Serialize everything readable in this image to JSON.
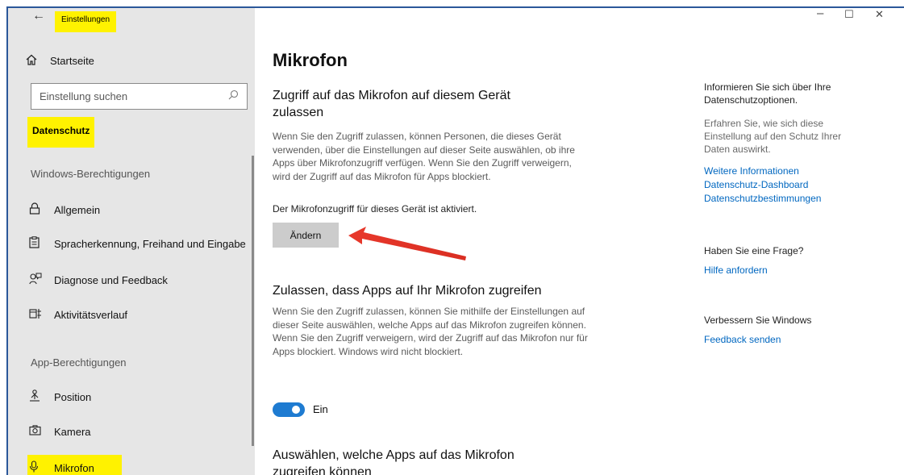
{
  "window": {
    "app_title": "Einstellungen",
    "caption": {
      "minimize": "–",
      "maximize": "☐",
      "close": "✕"
    }
  },
  "sidebar": {
    "home_label": "Startseite",
    "search_placeholder": "Einstellung suchen",
    "section_title": "Datenschutz",
    "windows_permissions_label": "Windows-Berechtigungen",
    "app_permissions_label": "App-Berechtigungen",
    "items": [
      {
        "label": "Allgemein",
        "icon": "lock-icon"
      },
      {
        "label": "Spracherkennung, Freihand und Eingabe",
        "icon": "clipboard-icon"
      },
      {
        "label": "Diagnose und Feedback",
        "icon": "people-feedback-icon"
      },
      {
        "label": "Aktivitätsverlauf",
        "icon": "timeline-icon"
      },
      {
        "label": "Position",
        "icon": "location-person-icon"
      },
      {
        "label": "Kamera",
        "icon": "camera-icon"
      },
      {
        "label": "Mikrofon",
        "icon": "microphone-icon"
      }
    ]
  },
  "main": {
    "page_title": "Mikrofon",
    "device_access": {
      "heading_line1": "Zugriff auf das Mikrofon auf diesem Gerät",
      "heading_line2": "zulassen",
      "description": "Wenn Sie den Zugriff zulassen, können Personen, die dieses Gerät verwenden, über die Einstellungen auf dieser Seite auswählen, ob ihre Apps über Mikrofonzugriff verfügen. Wenn Sie den Zugriff verweigern, wird der Zugriff auf das Mikrofon für Apps blockiert.",
      "status": "Der Mikrofonzugriff für dieses Gerät ist aktiviert.",
      "change_button": "Ändern"
    },
    "app_access": {
      "heading": "Zulassen, dass Apps auf Ihr Mikrofon zugreifen",
      "description": "Wenn Sie den Zugriff zulassen, können Sie mithilfe der Einstellungen auf dieser Seite auswählen, welche Apps auf das Mikrofon zugreifen können. Wenn Sie den Zugriff verweigern, wird der Zugriff auf das Mikrofon nur für Apps blockiert. Windows wird nicht blockiert.",
      "toggle_state": "Ein"
    },
    "choose_apps": {
      "heading_line1": "Auswählen, welche Apps auf das Mikrofon",
      "heading_line2": "zugreifen können"
    }
  },
  "right_panel": {
    "privacy_heading": "Informieren Sie sich über Ihre Datenschutzoptionen.",
    "privacy_text": "Erfahren Sie, wie sich diese Einstellung auf den Schutz Ihrer Daten auswirkt.",
    "links": [
      "Weitere Informationen",
      "Datenschutz-Dashboard",
      "Datenschutzbestimmungen"
    ],
    "question_heading": "Haben Sie eine Frage?",
    "question_link": "Hilfe anfordern",
    "improve_heading": "Verbessern Sie Windows",
    "improve_link": "Feedback senden"
  },
  "colors": {
    "accent": "#1e7bd1",
    "link": "#0067c0",
    "highlight": "#fff200",
    "annotation_arrow": "#e8382b",
    "sidebar_bg": "#e6e6e6"
  }
}
